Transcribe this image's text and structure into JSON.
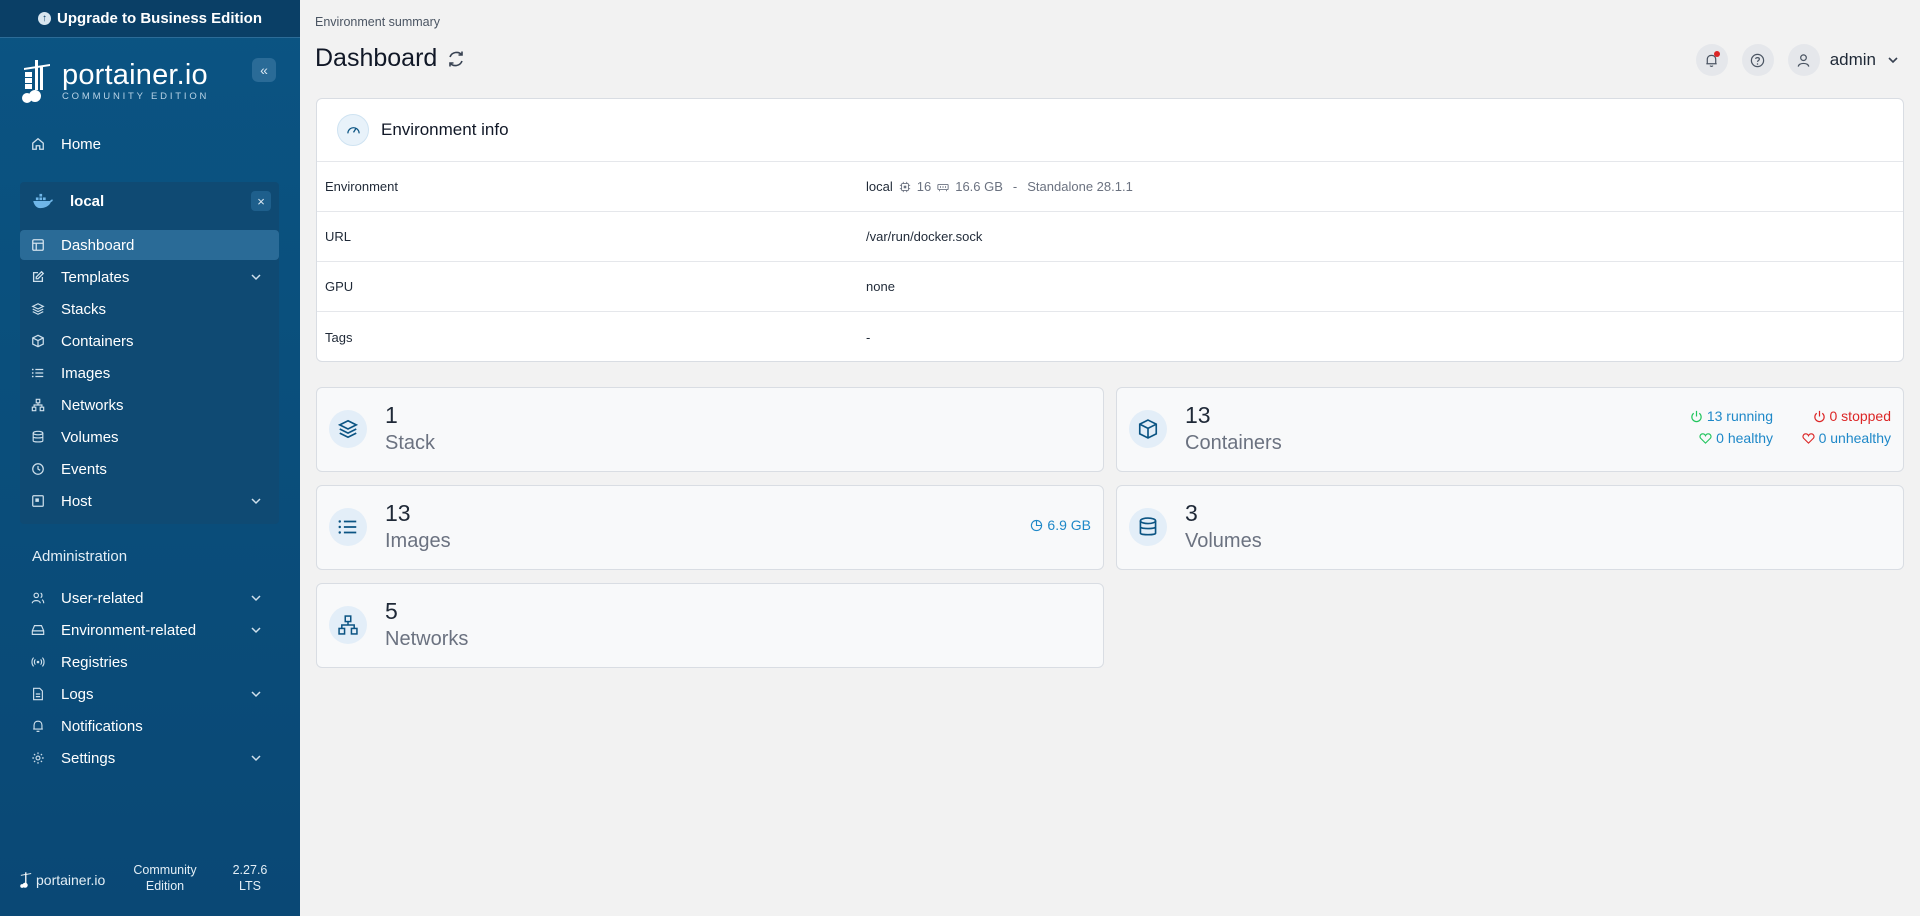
{
  "sidebar": {
    "upgrade_label": "Upgrade to Business Edition",
    "brand": {
      "name": "portainer.io",
      "edition": "COMMUNITY EDITION"
    },
    "home_label": "Home",
    "environment": {
      "name": "local",
      "items": [
        {
          "label": "Dashboard",
          "icon": "dashboard-icon",
          "active": true
        },
        {
          "label": "Templates",
          "icon": "edit-icon",
          "expandable": true
        },
        {
          "label": "Stacks",
          "icon": "layers-icon"
        },
        {
          "label": "Containers",
          "icon": "box-icon"
        },
        {
          "label": "Images",
          "icon": "list-icon"
        },
        {
          "label": "Networks",
          "icon": "network-icon"
        },
        {
          "label": "Volumes",
          "icon": "database-icon"
        },
        {
          "label": "Events",
          "icon": "clock-icon"
        },
        {
          "label": "Host",
          "icon": "host-icon",
          "expandable": true
        }
      ]
    },
    "admin_title": "Administration",
    "admin_items": [
      {
        "label": "User-related",
        "icon": "users-icon",
        "expandable": true
      },
      {
        "label": "Environment-related",
        "icon": "drive-icon",
        "expandable": true
      },
      {
        "label": "Registries",
        "icon": "radio-icon"
      },
      {
        "label": "Logs",
        "icon": "file-icon",
        "expandable": true
      },
      {
        "label": "Notifications",
        "icon": "bell-icon"
      },
      {
        "label": "Settings",
        "icon": "gear-icon",
        "expandable": true
      }
    ],
    "footer": {
      "brand": "portainer.io",
      "edition_line1": "Community",
      "edition_line2": "Edition",
      "version_line1": "2.27.6",
      "version_line2": "LTS"
    }
  },
  "header": {
    "breadcrumb": "Environment summary",
    "title": "Dashboard",
    "user": "admin"
  },
  "env_info": {
    "title": "Environment info",
    "rows": {
      "environment_key": "Environment",
      "environment_name": "local",
      "cpu": "16",
      "memory": "16.6 GB",
      "separator": "-",
      "mode": "Standalone 28.1.1",
      "url_key": "URL",
      "url_val": "/var/run/docker.sock",
      "gpu_key": "GPU",
      "gpu_val": "none",
      "tags_key": "Tags",
      "tags_val": "-"
    }
  },
  "stats": {
    "stack": {
      "count": "1",
      "label": "Stack"
    },
    "containers": {
      "count": "13",
      "label": "Containers",
      "running": "13 running",
      "stopped": "0 stopped",
      "healthy": "0 healthy",
      "unhealthy": "0 unhealthy"
    },
    "images": {
      "count": "13",
      "label": "Images",
      "size": "6.9 GB"
    },
    "volumes": {
      "count": "3",
      "label": "Volumes"
    },
    "networks": {
      "count": "5",
      "label": "Networks"
    }
  },
  "colors": {
    "sidebar": "#0b5483",
    "accent": "#1e88c8",
    "danger": "#dc2626",
    "success": "#22c55e"
  }
}
